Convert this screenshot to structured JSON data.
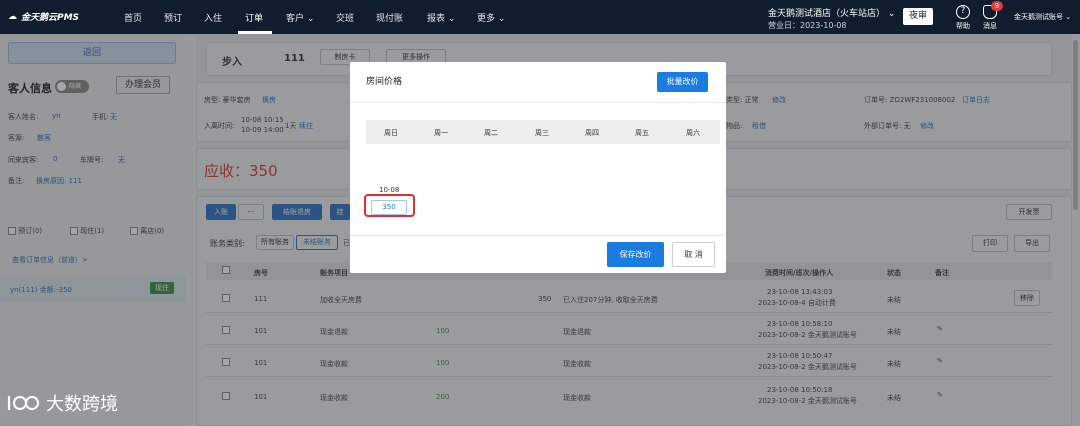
{
  "nav": {
    "logo": "金天鹅云PMS",
    "items": [
      "首页",
      "预订",
      "入住",
      "订单",
      "客户",
      "交班",
      "现付账",
      "报表",
      "更多"
    ],
    "hotel": "金天鹅测试酒店（火车站店）",
    "biz_date": "营业日：2023-10-08",
    "night_audit": "夜审",
    "help": "帮助",
    "messages": "消息",
    "badge": "9",
    "user": "金天鹅测试账号"
  },
  "left": {
    "back": "返回",
    "guest_title": "客人信息",
    "toggle": "隐藏",
    "member_btn": "办理会员",
    "name_label": "客人姓名:",
    "name_value": "yn",
    "phone_label": "手机:",
    "phone_value": "无",
    "source_label": "客源:",
    "source_value": "散客",
    "companion_label": "同来宾客:",
    "companion_value": "0",
    "plate_label": "车牌号:",
    "plate_value": "无",
    "remark_label": "备注:",
    "remark_value": "换房原因: 111",
    "chk_booked": "预订(0)",
    "chk_inhouse": "现住(1)",
    "chk_left": "离店(0)",
    "order_link": "查看订单信息（前道）>",
    "room_row": "yn(111)  余额:-350",
    "room_status": "现住"
  },
  "main": {
    "checkin": "步入",
    "room_no": "111",
    "btn_card": "制房卡",
    "btn_more": "更多操作",
    "room_type": "房型: 豪华套房",
    "change_room": "换房",
    "arrive_label": "入离时间:",
    "arrive_time": "10-08 10:15",
    "leave_time": "10-09 14:00",
    "days": "1天",
    "renew": "续住",
    "type_label": "类型: 正常",
    "modify": "修改",
    "order_no": "订单号: ZO2WF231008002",
    "order_log": "订单日志",
    "goods_label": "物品:",
    "rent": "租借",
    "ext_order": "外部订单号: 无",
    "ext_modify": "修改",
    "receivable": "应收：350",
    "btn_entry": "入账",
    "btn_more_dots": "···",
    "btn_settle": "结账退房",
    "btn_settle2": "挂",
    "btn_invoice": "开发票",
    "btn_print": "打印",
    "btn_export": "导出",
    "acct_label": "账务类别:",
    "acct_all": "所有账务",
    "acct_unsettled": "未结账务",
    "acct_more": "已",
    "headers": [
      "房号",
      "账务项目",
      "消费时间/班次/操作人",
      "状态",
      "备注"
    ],
    "rows": [
      {
        "room": "111",
        "item": "加收全天房费",
        "amount": "350",
        "desc": "已入住207分钟, 收取全天房费",
        "time": "23-10-08 13:43:03",
        "shift": "2023-10-08-4 自动计费",
        "status": "未结",
        "action": "移除"
      },
      {
        "room": "101",
        "item": "现金退款",
        "amount": "100",
        "desc": "现金退款",
        "time": "23-10-08 10:58:10",
        "shift": "2023-10-08-2 金天鹅测试账号",
        "status": "未结",
        "action": ""
      },
      {
        "room": "101",
        "item": "现金收款",
        "amount": "100",
        "desc": "现金收款",
        "time": "23-10-08 10:50:47",
        "shift": "2023-10-08-2 金天鹅测试账号",
        "status": "未结",
        "action": ""
      },
      {
        "room": "101",
        "item": "现金收款",
        "amount": "200",
        "desc": "现金收款",
        "time": "23-10-08 10:50:18",
        "shift": "2023-10-08-2 金天鹅测试账号",
        "status": "未结",
        "action": ""
      }
    ]
  },
  "modal": {
    "title": "房间价格",
    "batch": "批量改价",
    "weekdays": [
      "周日",
      "周一",
      "周二",
      "周三",
      "周四",
      "周五",
      "周六"
    ],
    "date": "10-08",
    "price": "350",
    "save": "保存改价",
    "cancel": "取 消"
  },
  "watermark": "大数跨境",
  "colors": {
    "nav_bg": "#101d2f",
    "primary": "#1a7be0",
    "danger": "#e23030",
    "success": "#3e8e4a"
  }
}
